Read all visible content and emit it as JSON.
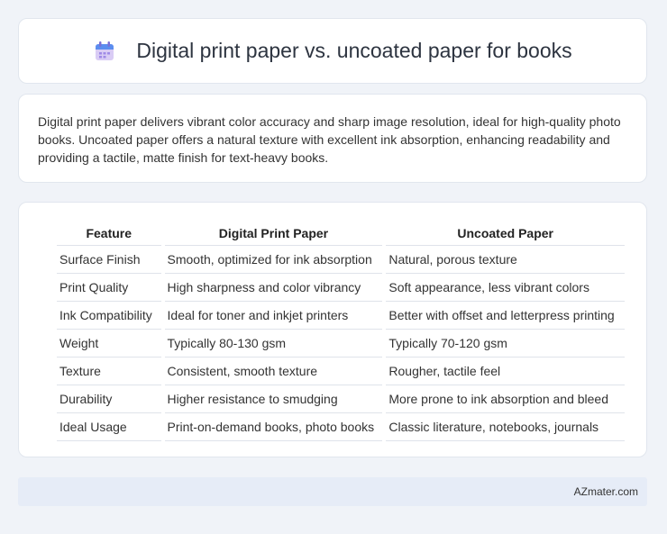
{
  "header": {
    "title": "Digital print paper vs. uncoated paper for books",
    "icon": "calendar-icon"
  },
  "description": "Digital print paper delivers vibrant color accuracy and sharp image resolution, ideal for high-quality photo books. Uncoated paper offers a natural texture with excellent ink absorption, enhancing readability and providing a tactile, matte finish for text-heavy books.",
  "table": {
    "headers": [
      "Feature",
      "Digital Print Paper",
      "Uncoated Paper"
    ],
    "rows": [
      [
        "Surface Finish",
        "Smooth, optimized for ink absorption",
        "Natural, porous texture"
      ],
      [
        "Print Quality",
        "High sharpness and color vibrancy",
        "Soft appearance, less vibrant colors"
      ],
      [
        "Ink Compatibility",
        "Ideal for toner and inkjet printers",
        "Better with offset and letterpress printing"
      ],
      [
        "Weight",
        "Typically 80-130 gsm",
        "Typically 70-120 gsm"
      ],
      [
        "Texture",
        "Consistent, smooth texture",
        "Rougher, tactile feel"
      ],
      [
        "Durability",
        "Higher resistance to smudging",
        "More prone to ink absorption and bleed"
      ],
      [
        "Ideal Usage",
        "Print-on-demand books, photo books",
        "Classic literature, notebooks, journals"
      ]
    ]
  },
  "footer": {
    "text": "AZmater.com"
  },
  "colors": {
    "background": "#f0f3f8",
    "card": "#ffffff",
    "footer": "#e6ecf7",
    "icon_top": "#5b8def",
    "icon_body": "#c9b8f0"
  }
}
